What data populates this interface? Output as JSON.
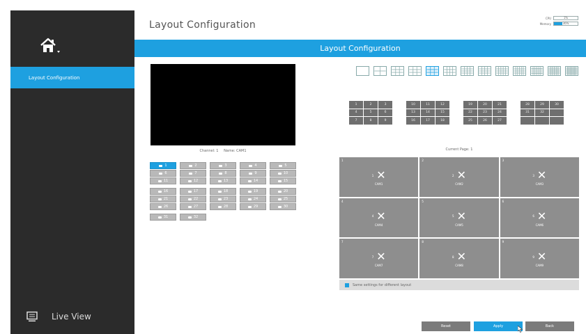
{
  "sidebar": {
    "active_item": "Layout Configuration",
    "bottom_item": "Live View"
  },
  "header": {
    "title": "Layout Configuration",
    "cpu_label": "CPU",
    "cpu_value": "1%",
    "memory_label": "Memory",
    "memory_value": "36%",
    "memory_fill": 0.36
  },
  "banner": {
    "title": "Layout Configuration"
  },
  "preview": {
    "channel_label": "Channel: 1",
    "name_label": "Name: CAM1"
  },
  "channels": [
    "1",
    "2",
    "3",
    "4",
    "5",
    "6",
    "7",
    "8",
    "9",
    "10",
    "11",
    "12",
    "13",
    "14",
    "15",
    "16",
    "17",
    "18",
    "19",
    "20",
    "21",
    "22",
    "23",
    "24",
    "25",
    "26",
    "27",
    "28",
    "29",
    "30",
    "31",
    "32"
  ],
  "selected_channel": "1",
  "layout_count": 13,
  "selected_layout_index": 4,
  "page_groups": [
    [
      "1",
      "2",
      "3",
      "4",
      "5",
      "6",
      "7",
      "8",
      "9"
    ],
    [
      "10",
      "11",
      "12",
      "13",
      "14",
      "15",
      "16",
      "17",
      "18"
    ],
    [
      "19",
      "20",
      "21",
      "22",
      "23",
      "24",
      "25",
      "26",
      "27"
    ],
    [
      "28",
      "29",
      "30",
      "31",
      "32",
      "",
      "",
      "",
      ""
    ]
  ],
  "current_page": "Current Page: 1",
  "tiles": [
    {
      "index": "1",
      "num": "1",
      "cam": "CAM1"
    },
    {
      "index": "2",
      "num": "2",
      "cam": "CAM2"
    },
    {
      "index": "3",
      "num": "3",
      "cam": "CAM3"
    },
    {
      "index": "4",
      "num": "4",
      "cam": "CAM4"
    },
    {
      "index": "5",
      "num": "5",
      "cam": "CAM5"
    },
    {
      "index": "6",
      "num": "6",
      "cam": "CAM6"
    },
    {
      "index": "7",
      "num": "7",
      "cam": "CAM7"
    },
    {
      "index": "8",
      "num": "8",
      "cam": "CAM8"
    },
    {
      "index": "9",
      "num": "9",
      "cam": "CAM9"
    }
  ],
  "same_settings_label": "Same settings for different layout",
  "buttons": {
    "reset": "Reset",
    "apply": "Apply",
    "back": "Back"
  },
  "colors": {
    "accent": "#1ea0e0",
    "sidebar": "#2b2b2b",
    "tile": "#8e8e8e"
  }
}
